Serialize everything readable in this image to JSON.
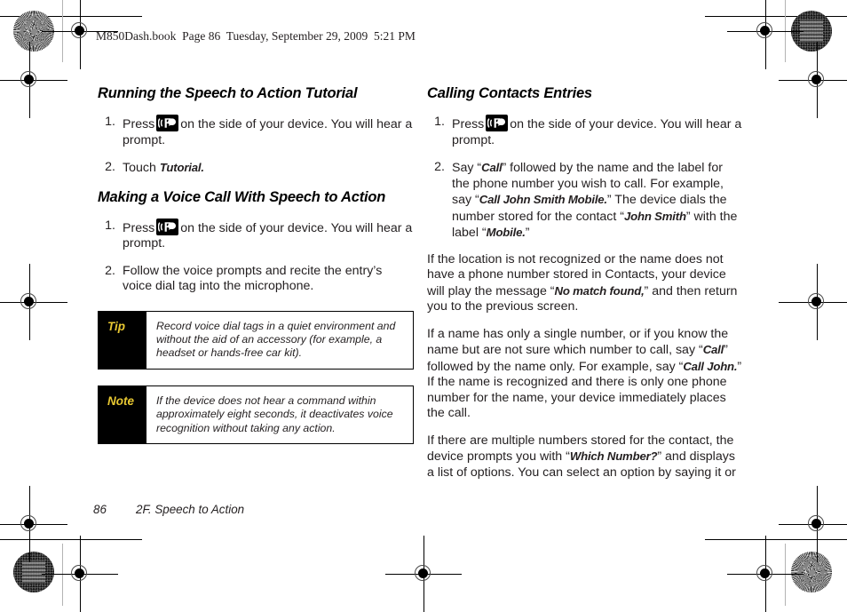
{
  "page_header": "M850Dash.book  Page 86  Tuesday, September 29, 2009  5:21 PM",
  "icons": {
    "voice_command": "voice-command-icon"
  },
  "left_column": {
    "section_1": {
      "heading": "Running the Speech to Action Tutorial",
      "steps": [
        {
          "num": "1.",
          "text_before": "Press",
          "has_icon": true,
          "text_after": "on the side of your device. You will hear a prompt."
        },
        {
          "num": "2.",
          "text_before": "Touch",
          "has_icon": false,
          "emphasis": "Tutorial.",
          "text_after": ""
        }
      ]
    },
    "section_2": {
      "heading": "Making a Voice Call With Speech to Action",
      "steps": [
        {
          "num": "1.",
          "text_before": "Press",
          "has_icon": true,
          "text_after": "on the side of your device. You will hear a prompt."
        },
        {
          "num": "2.",
          "text_before": "Follow the voice prompts and recite the entry’s voice dial tag into the microphone.",
          "has_icon": false,
          "text_after": ""
        }
      ]
    },
    "callouts": [
      {
        "tag": "Tip",
        "text": "Record voice dial tags in a quiet environment and without the aid of an accessory (for example, a headset or hands-free car kit)."
      },
      {
        "tag": "Note",
        "text": "If the device does not hear a command within approximately eight seconds, it deactivates voice recognition without taking any action."
      }
    ]
  },
  "right_column": {
    "heading": "Calling Contacts Entries",
    "steps": [
      {
        "num": "1.",
        "text_before": "Press",
        "has_icon": true,
        "text_after": "on the side of your device. You will hear a prompt."
      },
      {
        "num": "2.",
        "seg_1": "Say “",
        "em_1": "Call",
        "seg_2": "” followed by the name and the label for the phone number you wish to call. For example, say “",
        "em_2": "Call John Smith Mobile.",
        "seg_3": "” The device dials the number stored for the contact “",
        "em_3": "John Smith",
        "seg_4": "” with the label “",
        "em_4": "Mobile.",
        "seg_5": "”"
      }
    ],
    "paragraphs": [
      {
        "seg_1": "If the location is not recognized or the name does not have a phone number stored in Contacts, your device will play the message “",
        "em_1": "No match found,",
        "seg_2": "” and then return you to the previous screen."
      },
      {
        "seg_1": "If a name has only a single number, or if you know the name but are not sure which number to call, say “",
        "em_1": "Call",
        "seg_2": "” followed by the name only. For example, say “",
        "em_2": "Call John.",
        "seg_3": "” If the name is recognized and there is only one phone number for the name, your device immediately places the call."
      },
      {
        "seg_1": "If there are multiple numbers stored for the contact, the device prompts you with “",
        "em_1": "Which Number?",
        "seg_2": "” and displays a list of options. You can select an option by saying it or"
      }
    ]
  },
  "footer": {
    "page_number": "86",
    "chapter": "2F. Speech to Action"
  }
}
